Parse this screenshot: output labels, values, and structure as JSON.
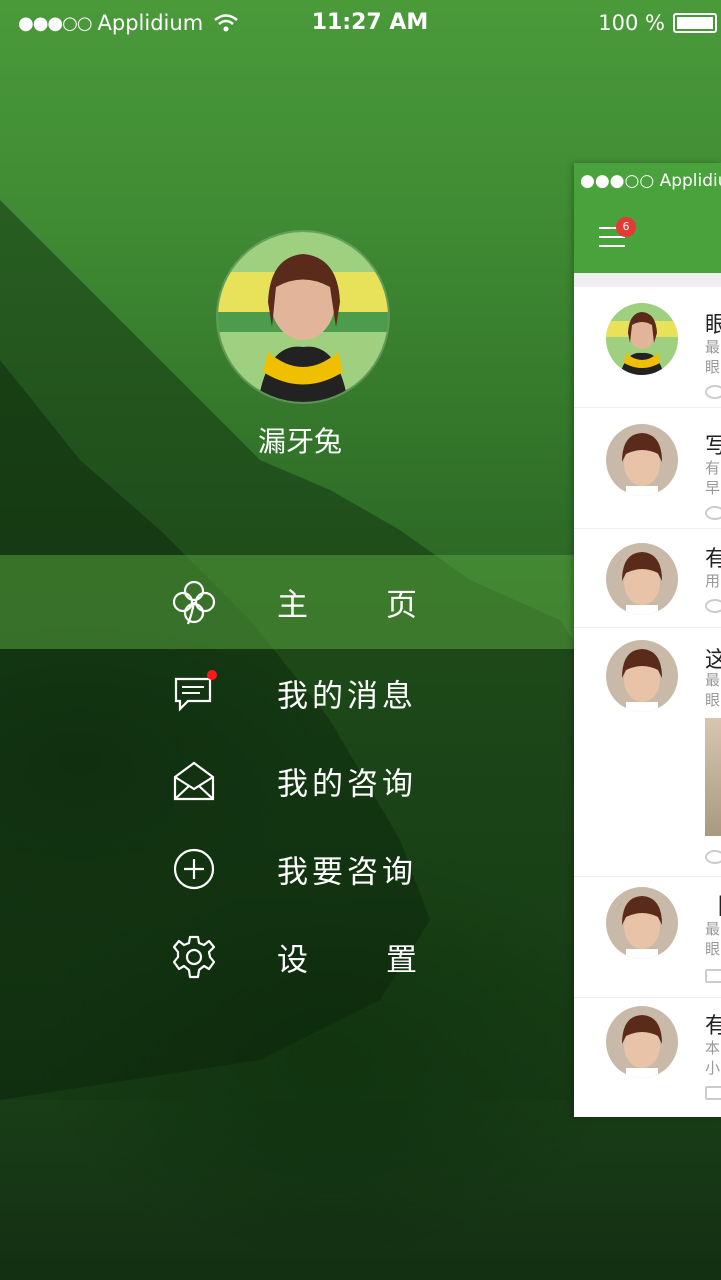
{
  "status_bar": {
    "signal": "●●●○○",
    "carrier": "Applidium",
    "time": "11:27 AM",
    "battery": "100 %"
  },
  "profile": {
    "username": "漏牙兔"
  },
  "menu": {
    "home": [
      "主",
      "页"
    ],
    "messages": "我的消息",
    "consultations": "我的咨询",
    "ask": "我要咨询",
    "settings": [
      "设",
      "置"
    ]
  },
  "panel": {
    "status_text": "●●●○○ Applidium",
    "badge_count": "6",
    "items": [
      {
        "title": "眼",
        "sub1": "最",
        "sub2": "眼"
      },
      {
        "title": "写",
        "sub1": "有",
        "sub2": "早"
      },
      {
        "title": "有",
        "sub1": "用",
        "sub2": ""
      },
      {
        "title": "这",
        "sub1": "最",
        "sub2": "眼"
      },
      {
        "title": "【",
        "sub1": "最",
        "sub2": "眼"
      },
      {
        "title": "有",
        "sub1": "本",
        "sub2": "小"
      }
    ]
  },
  "colors": {
    "accent": "#4aa23c",
    "badge": "#e53935"
  }
}
